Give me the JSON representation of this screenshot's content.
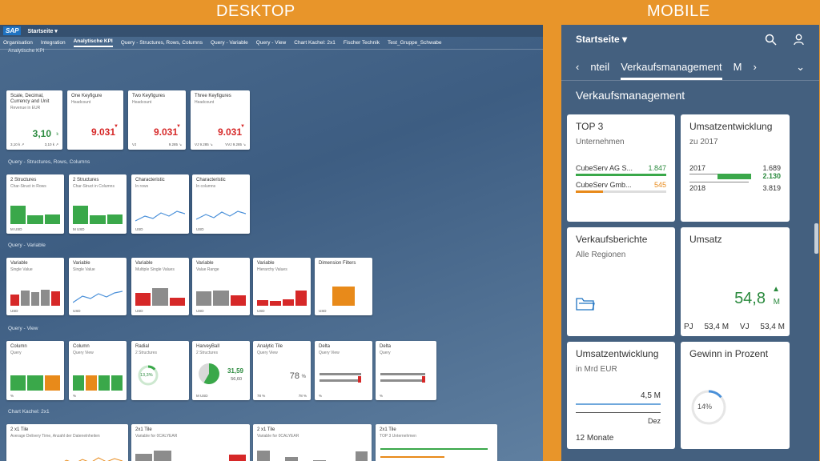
{
  "banners": {
    "desktop": "DESKTOP",
    "mobile": "MOBILE"
  },
  "desktop": {
    "logo": "SAP",
    "shell_title": "Startseite ▾",
    "nav": [
      "Organisation",
      "Integration",
      "Analytische KPI",
      "Query - Structures, Rows, Columns",
      "Query - Variable",
      "Query - View",
      "Chart Kachel: 2x1",
      "Fischer Technik",
      "Test_Gruppe_Schwabe"
    ],
    "section_top": "Analytische KPI",
    "kpi_tiles": [
      {
        "title": "Scale, Decimal, Currency and Unit",
        "sub": "Revenue in EUR",
        "value": "3,10",
        "unit": "k",
        "foot_l": "3,10 k ↗",
        "foot_r": "3,10 k ↗"
      },
      {
        "title": "One Keyfigure",
        "sub": "Headcount",
        "value": "9.031",
        "foot_l": "",
        "foot_r": ""
      },
      {
        "title": "Two Keyfigures",
        "sub": "Headcount",
        "value": "9.031",
        "foot_l": "VJ",
        "foot_r": "9.285 ↘"
      },
      {
        "title": "Three Keyfigures",
        "sub": "Headcount",
        "value": "9.031",
        "foot_l": "VJ 9.285 ↘",
        "foot_r": "VVJ 9.285 ↘"
      }
    ],
    "section_structures": "Query - Structures, Rows, Columns",
    "structure_tiles": [
      {
        "title": "2 Structures",
        "sub": "Char-Struct in Rows",
        "unit": "M USD"
      },
      {
        "title": "2 Structures",
        "sub": "Char-Struct in Columns",
        "unit": "M USD"
      },
      {
        "title": "Characteristic",
        "sub": "In rows",
        "unit": "USD"
      },
      {
        "title": "Characteristic",
        "sub": "In columns",
        "unit": "USD"
      }
    ],
    "section_variable": "Query - Variable",
    "variable_tiles": [
      {
        "title": "Variable",
        "sub": "Single Value",
        "unit": "USD"
      },
      {
        "title": "Variable",
        "sub": "Single Value",
        "unit": "USD"
      },
      {
        "title": "Variable",
        "sub": "Multiple Single Values",
        "unit": "USD"
      },
      {
        "title": "Variable",
        "sub": "Value Range",
        "unit": "USD"
      },
      {
        "title": "Variable",
        "sub": "Hierarchy Values",
        "unit": "USD"
      },
      {
        "title": "Dimension Filters",
        "sub": "",
        "unit": "USD"
      }
    ],
    "section_view": "Query - View",
    "view_tiles": [
      {
        "title": "Column",
        "sub": "Query",
        "unit": "%"
      },
      {
        "title": "Column",
        "sub": "Query View",
        "unit": "%"
      },
      {
        "title": "Radial",
        "sub": "2 Structures",
        "value": "13,3%"
      },
      {
        "title": "HarveyBall",
        "sub": "2 Structures",
        "value": "31,59",
        "sub2": "56,60",
        "unit": "M USD"
      },
      {
        "title": "Analytic Tile",
        "sub": "Query View",
        "value": "78",
        "value_unit": "%",
        "foot_l": "78 %",
        "foot_r": "78 %"
      },
      {
        "title": "Delta",
        "sub": "Query View",
        "unit": "%"
      },
      {
        "title": "Delta",
        "sub": "Query",
        "unit": "%"
      }
    ],
    "section_chart": "Chart Kachel: 2x1",
    "chart_tiles": [
      {
        "title": "2 x1 Tile",
        "sub": "Average Delivery Time, Anzahl der Datenelnheiten"
      },
      {
        "title": "2x1 Tile",
        "sub": "Variable for 0CALYEAR"
      },
      {
        "title": "2 x1 Tile",
        "sub": "Variable for 0CALYEAR"
      },
      {
        "title": "2x1 Tile",
        "sub": "TOP 3 Unternehmen"
      }
    ]
  },
  "mobile": {
    "shell_title": "Startseite ▾",
    "tabs": {
      "left_arrow": "‹",
      "prev": "nteil",
      "active": "Verkaufsmanagement",
      "next": "M",
      "right_arrow": "›",
      "more": "⌄"
    },
    "page_title": "Verkaufsmanagement",
    "top3": {
      "title": "TOP 3",
      "sub": "Unternehmen",
      "r1_label": "CubeServ AG S...",
      "r1_val": "1.847",
      "r1_frac": 1.0,
      "r2_label": "CubeServ Gmb...",
      "r2_val": "545",
      "r2_frac": 0.3
    },
    "umsatzentwicklung": {
      "title": "Umsatzentwicklung",
      "sub": "zu 2017",
      "y1": "2017",
      "v1": "1.689",
      "v2": "2.130",
      "y2": "2018",
      "v3": "3.819"
    },
    "verkaufsberichte": {
      "title": "Verkaufsberichte",
      "sub": "Alle Regionen"
    },
    "umsatz": {
      "title": "Umsatz",
      "value": "54,8",
      "unit": "M",
      "pj_label": "PJ",
      "pj_val": "53,4 M",
      "vj_label": "VJ",
      "vj_val": "53,4 M"
    },
    "umsatz_mrd": {
      "title": "Umsatzentwicklung",
      "sub": "in Mrd EUR",
      "value": "4,5 M",
      "axis": "Dez",
      "foot": "12 Monate"
    },
    "gewinn": {
      "title": "Gewinn in Prozent",
      "value": "14%",
      "pct": 0.14
    },
    "colors": {
      "green": "#2b8a3e",
      "orange": "#e88a1a",
      "blue": "#1f73c2"
    }
  }
}
